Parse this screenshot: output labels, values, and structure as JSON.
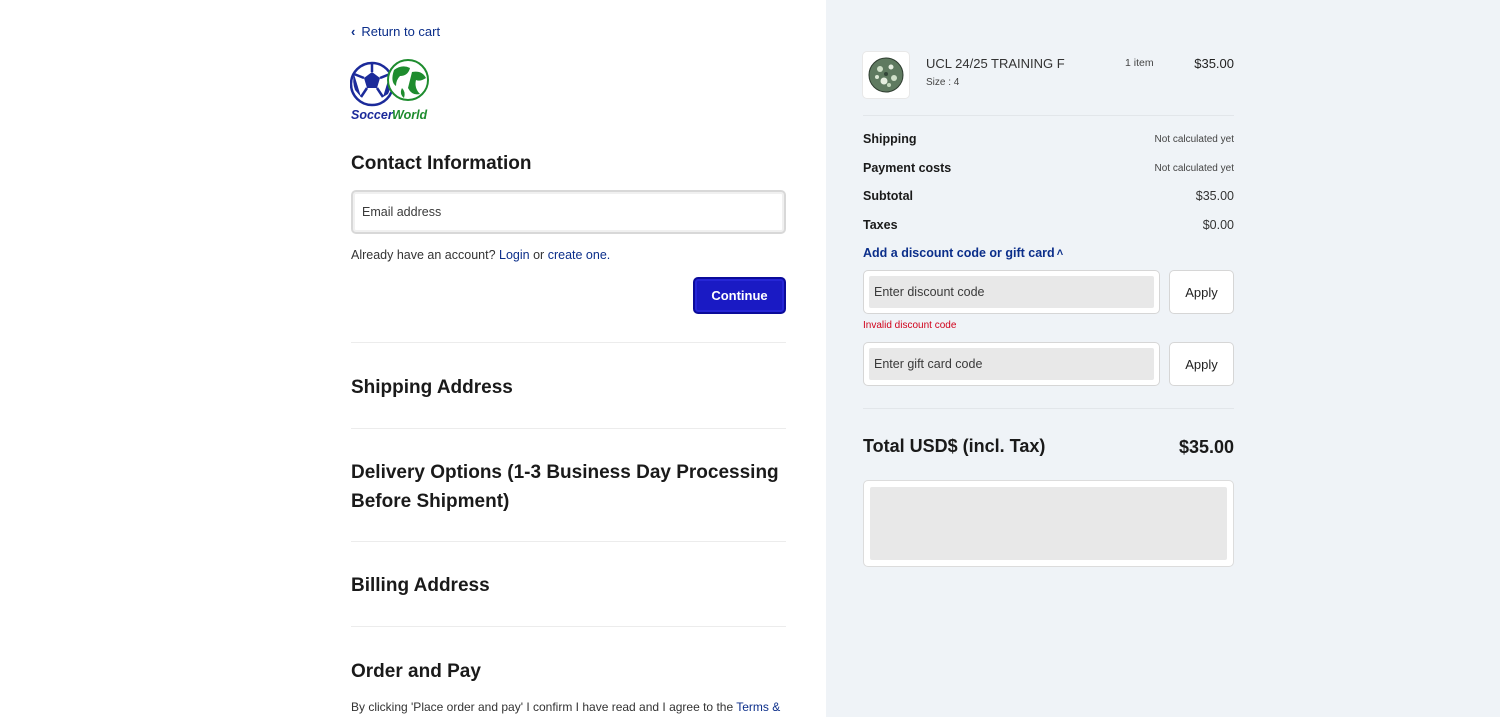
{
  "nav": {
    "return_label": "Return to cart"
  },
  "brand": {
    "logo_text": "SoccerWorld"
  },
  "contact": {
    "title": "Contact Information",
    "email_placeholder": "Email address",
    "account_prefix": "Already have an account?",
    "login_label": "Login",
    "or_text": "or",
    "create_label": "create one.",
    "continue_label": "Continue"
  },
  "sections": {
    "shipping": "Shipping Address",
    "delivery_line1": "Delivery Options (1-3 Business Day Processing",
    "delivery_line2": "Before Shipment)",
    "billing": "Billing Address",
    "order": "Order and Pay"
  },
  "legal": {
    "text": "By clicking 'Place order and pay' I confirm I have read and I agree to the",
    "terms_link": "Terms &"
  },
  "cart": {
    "item_name": "UCL 24/25 TRAINING F",
    "item_size": "Size : 4",
    "item_qty": "1 item",
    "item_price": "$35.00"
  },
  "summary": {
    "shipping_label": "Shipping",
    "shipping_value": "Not calculated yet",
    "payment_label": "Payment costs",
    "payment_value": "Not calculated yet",
    "subtotal_label": "Subtotal",
    "subtotal_value": "$35.00",
    "taxes_label": "Taxes",
    "taxes_value": "$0.00"
  },
  "discount": {
    "toggle_label": "Add a discount code or gift card",
    "discount_placeholder": "Enter discount code",
    "apply_label": "Apply",
    "error_text": "Invalid discount code",
    "gift_placeholder": "Enter gift card code",
    "gift_apply_label": "Apply"
  },
  "total": {
    "label": "Total USD$ (incl. Tax)",
    "value": "$35.00"
  },
  "colors": {
    "accent": "#1a1ac4",
    "link": "#0b2e8a",
    "error": "#d0021b",
    "panel": "#eff3f7"
  }
}
